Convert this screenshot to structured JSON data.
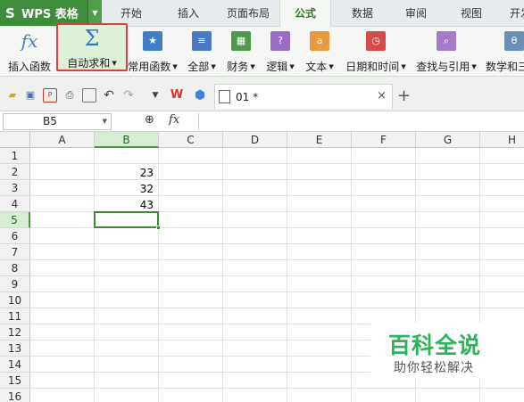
{
  "app": {
    "title": "WPS 表格",
    "logo": "S"
  },
  "menu": {
    "tabs": [
      {
        "label": "开始"
      },
      {
        "label": "插入"
      },
      {
        "label": "页面布局"
      },
      {
        "label": "公式",
        "active": true
      },
      {
        "label": "数据"
      },
      {
        "label": "审阅"
      },
      {
        "label": "视图"
      },
      {
        "label": "开发"
      }
    ]
  },
  "ribbon": {
    "insert_function": "插入函数",
    "auto_sum": "自动求和",
    "common_functions": "常用函数",
    "all": "全部",
    "finance": "财务",
    "logic": "逻辑",
    "text": "文本",
    "datetime": "日期和时间",
    "lookup": "查找与引用",
    "math": "数学和三"
  },
  "ribbon_icons": {
    "fx": "fx",
    "sigma": "Σ",
    "star": "★",
    "list": "≡",
    "table": "▦",
    "question": "?",
    "letter_a": "a",
    "clock": "◷",
    "search": "⌕",
    "theta": "θ"
  },
  "colors": {
    "brand_green": "#3e8d3a",
    "highlight_red": "#e33c3c",
    "selection_green": "#4b9a3f",
    "watermark_green": "#2fb35a"
  },
  "doc_tab": {
    "title": "01 *",
    "close": "×",
    "add": "+"
  },
  "formula_bar": {
    "name_box": "B5",
    "fx_label": "fx",
    "zoom_icon": "⊕"
  },
  "grid": {
    "columns": [
      "A",
      "B",
      "C",
      "D",
      "E",
      "F",
      "G",
      "H"
    ],
    "rows": [
      "1",
      "2",
      "3",
      "4",
      "5",
      "6",
      "7",
      "8",
      "9",
      "10",
      "11",
      "12",
      "13",
      "14",
      "15",
      "16"
    ],
    "selected_column": "B",
    "selected_row": "5",
    "cells": {
      "B2": "23",
      "B3": "32",
      "B4": "43"
    }
  },
  "watermark": {
    "title": "百科全说",
    "subtitle": "助你轻松解决"
  }
}
